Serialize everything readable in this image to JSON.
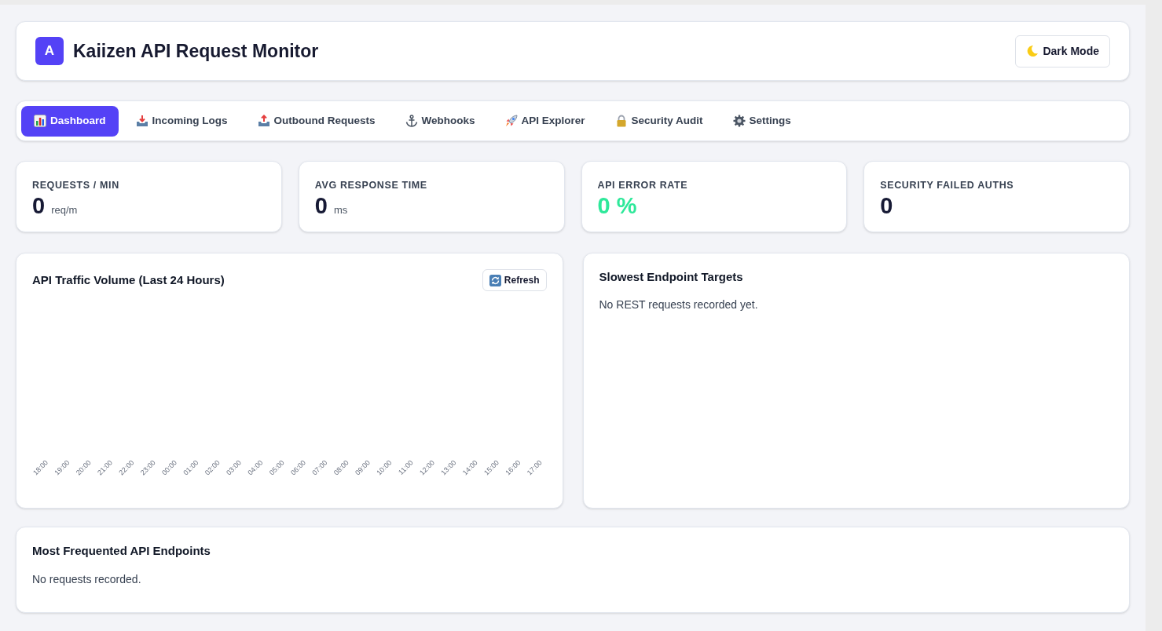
{
  "header": {
    "logo": "A",
    "title": "Kaiizen API Request Monitor",
    "theme_button": "Dark Mode"
  },
  "tabs": [
    {
      "label": "Dashboard",
      "selected": true
    },
    {
      "label": "Incoming Logs",
      "selected": false
    },
    {
      "label": "Outbound Requests",
      "selected": false
    },
    {
      "label": "Webhooks",
      "selected": false
    },
    {
      "label": "API Explorer",
      "selected": false
    },
    {
      "label": "Security Audit",
      "selected": false
    },
    {
      "label": "Settings",
      "selected": false
    }
  ],
  "stats": [
    {
      "label": "REQUESTS / MIN",
      "value": "0",
      "unit": "req/m",
      "color": "#171a35"
    },
    {
      "label": "AVG RESPONSE TIME",
      "value": "0",
      "unit": "ms",
      "color": "#171a35"
    },
    {
      "label": "API ERROR RATE",
      "value": "0 %",
      "color": "#2ee89a"
    },
    {
      "label": "SECURITY FAILED AUTHS",
      "value": "0",
      "color": "#171a35"
    }
  ],
  "traffic_card": {
    "title": "API Traffic Volume (Last 24 Hours)",
    "refresh_button": "Refresh",
    "x_axis_labels": [
      "18:00",
      "19:00",
      "20:00",
      "21:00",
      "22:00",
      "23:00",
      "00:00",
      "01:00",
      "02:00",
      "03:00",
      "04:00",
      "05:00",
      "06:00",
      "07:00",
      "08:00",
      "09:00",
      "10:00",
      "11:00",
      "12:00",
      "13:00",
      "14:00",
      "15:00",
      "16:00",
      "17:00"
    ]
  },
  "slowest_card": {
    "title": "Slowest Endpoint Targets",
    "empty_message": "No REST requests recorded yet."
  },
  "frequent_card": {
    "title": "Most Frequented API Endpoints",
    "empty_message": "No requests recorded."
  }
}
